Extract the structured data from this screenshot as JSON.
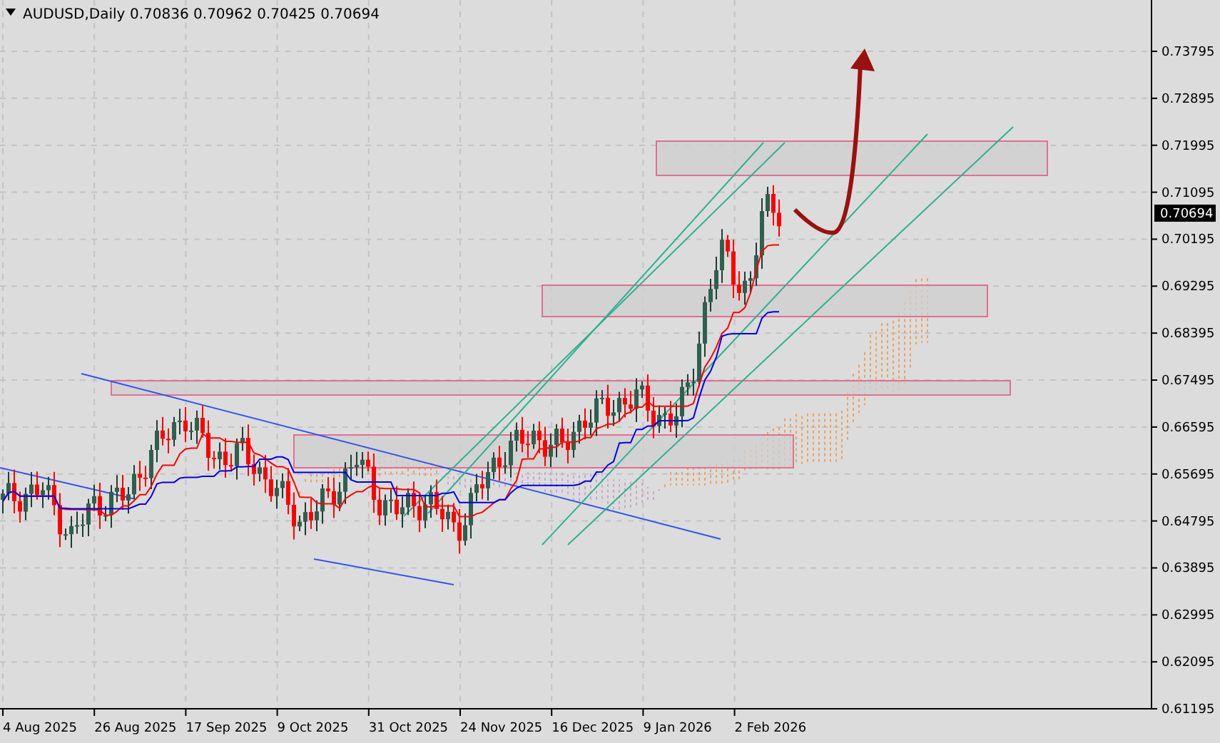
{
  "header": {
    "symbol_timeframe": "AUDUSD,Daily",
    "ohlc": [
      "0.70836",
      "0.70962",
      "0.70425",
      "0.70694"
    ]
  },
  "price_axis": [
    "0.73795",
    "0.72895",
    "0.71995",
    "0.71095",
    "0.70195",
    "0.69295",
    "0.68395",
    "0.67495",
    "0.66595",
    "0.65695",
    "0.64795",
    "0.63895",
    "0.62995",
    "0.62095",
    "0.61195"
  ],
  "current_price": "0.70694",
  "date_axis": [
    "4 Aug 2025",
    "26 Aug 2025",
    "17 Sep 2025",
    "9 Oct 2025",
    "31 Oct 2025",
    "24 Nov 2025",
    "16 Dec 2025",
    "9 Jan 2026",
    "2 Feb 2026"
  ]
}
